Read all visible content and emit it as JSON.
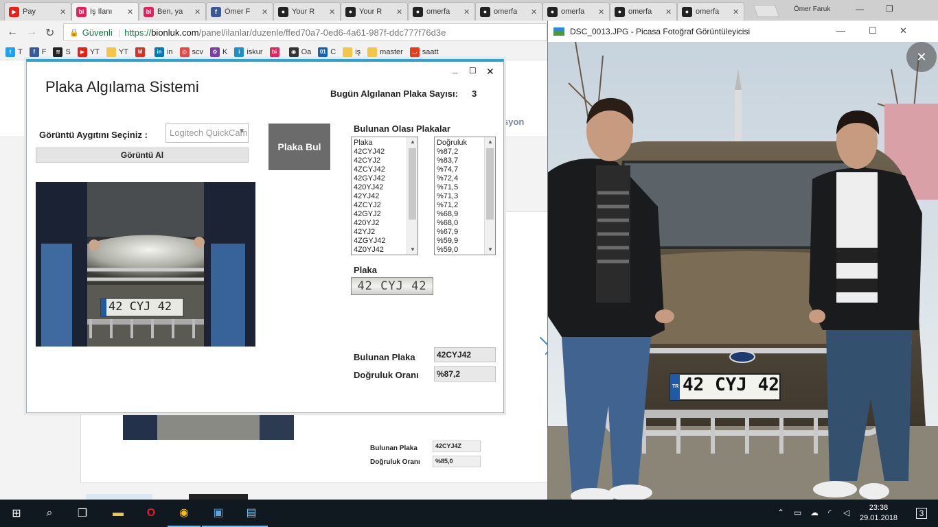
{
  "browser": {
    "tabs": [
      {
        "title": "Pay",
        "icon": "youtube-icon",
        "color": "#e62117",
        "glyph": "▶"
      },
      {
        "title": "İş İlanı",
        "icon": "bionluk-icon",
        "color": "#e0245e",
        "glyph": "bi"
      },
      {
        "title": "Ben, ya",
        "icon": "bionluk-icon",
        "color": "#e0245e",
        "glyph": "bi"
      },
      {
        "title": "Ömer F",
        "icon": "facebook-icon",
        "color": "#3b5998",
        "glyph": "f"
      },
      {
        "title": "Your R",
        "icon": "github-icon",
        "color": "#222222",
        "glyph": "●"
      },
      {
        "title": "Your R",
        "icon": "github-icon",
        "color": "#222222",
        "glyph": "●"
      },
      {
        "title": "omerfa",
        "icon": "github-icon",
        "color": "#222222",
        "glyph": "●"
      },
      {
        "title": "omerfa",
        "icon": "github-icon",
        "color": "#222222",
        "glyph": "●"
      },
      {
        "title": "omerfa",
        "icon": "github-icon",
        "color": "#222222",
        "glyph": "●"
      },
      {
        "title": "omerfa",
        "icon": "github-icon",
        "color": "#222222",
        "glyph": "●"
      },
      {
        "title": "omerfa",
        "icon": "github-icon",
        "color": "#222222",
        "glyph": "●"
      }
    ],
    "user": "Ömer Faruk",
    "secure_label": "Güvenli",
    "url_scheme": "https://",
    "url_host": "bionluk.com",
    "url_path": "/panel/ilanlar/duzenle/ffed70a7-0ed6-4a61-987f-ddc777f76d3e",
    "bookmarks": [
      {
        "label": "T",
        "icon": "twitter-icon",
        "color": "#1da1f2",
        "glyph": "t"
      },
      {
        "label": "F",
        "icon": "facebook-icon",
        "color": "#3b5998",
        "glyph": "f"
      },
      {
        "label": "S",
        "icon": "spotify-icon",
        "color": "#222222",
        "glyph": "≋"
      },
      {
        "label": "YT",
        "icon": "youtube-icon",
        "color": "#e62117",
        "glyph": "▶"
      },
      {
        "label": "YT",
        "icon": "folder-icon",
        "color": "#f2c64b",
        "glyph": ""
      },
      {
        "label": "",
        "icon": "gmail-icon",
        "color": "#d93025",
        "glyph": "M"
      },
      {
        "label": "in",
        "icon": "linkedin-icon",
        "color": "#0077b5",
        "glyph": "in"
      },
      {
        "label": "scv",
        "icon": "scv-icon",
        "color": "#e04a4a",
        "glyph": "◎"
      },
      {
        "label": "K",
        "icon": "k-icon",
        "color": "#7a3fa0",
        "glyph": "✿"
      },
      {
        "label": "iskur",
        "icon": "iskur-icon",
        "color": "#1e90c8",
        "glyph": "i"
      },
      {
        "label": "",
        "icon": "bionluk-icon",
        "color": "#e0245e",
        "glyph": "bi"
      },
      {
        "label": "Oa",
        "icon": "panda-icon",
        "color": "#333333",
        "glyph": "◉"
      },
      {
        "label": "C",
        "icon": "binary-icon",
        "color": "#1a5fb4",
        "glyph": "01"
      },
      {
        "label": "iş",
        "icon": "folder-icon",
        "color": "#f2c64b",
        "glyph": ""
      },
      {
        "label": "master",
        "icon": "folder-icon",
        "color": "#f2c64b",
        "glyph": ""
      },
      {
        "label": "saatt",
        "icon": "saat-icon",
        "color": "#e63b1f",
        "glyph": "◡"
      }
    ]
  },
  "webpage": {
    "nav_fragment": "syon",
    "found_label": "Bulunan Plaka",
    "found_value": "42CYJ4Z",
    "accuracy_label": "Doğruluk Oranı",
    "accuracy_value": "%85,0"
  },
  "app": {
    "title": "Plaka Algılama Sistemi",
    "count_label": "Bugün Algılanan Plaka Sayısı:",
    "count_value": "3",
    "device_label": "Görüntü Aygıtını Seçiniz :",
    "device_selected": "Logitech QuickCam",
    "capture_button": "Görüntü Al",
    "find_button": "Plaka Bul",
    "possible_label": "Bulunan Olası Plakalar",
    "plates_header": "Plaka",
    "plates": [
      "42CYJ42",
      "42CYJ2",
      "4ZCYJ42",
      "42GYJ42",
      "420YJ42",
      "42YJ42",
      "4ZCYJ2",
      "42GYJ2",
      "420YJ2",
      "42YJ2",
      "4ZGYJ42",
      "4Z0YJ42"
    ],
    "accuracy_header": "Doğruluk",
    "accuracies": [
      "%87,2",
      "%83,7",
      "%74,7",
      "%72,4",
      "%71,5",
      "%71,3",
      "%71,2",
      "%68,9",
      "%68,0",
      "%67,9",
      "%59,9",
      "%59,0"
    ],
    "plate_label": "Plaka",
    "plate_crop_text": "42 CYJ 42",
    "camera_plate_text": "42 CYJ 42",
    "found_label": "Bulunan Plaka",
    "found_value": "42CYJ42",
    "accuracy_label": "Doğruluk Oranı",
    "accuracy_value": "%87,2"
  },
  "picasa": {
    "title": "DSC_0013.JPG - Picasa Fotoğraf Görüntüleyicisi",
    "plate_text": "42 CYJ 42",
    "plate_country": "TR"
  },
  "taskbar": {
    "time": "23:38",
    "date": "29.01.2018",
    "notifications": "3"
  }
}
